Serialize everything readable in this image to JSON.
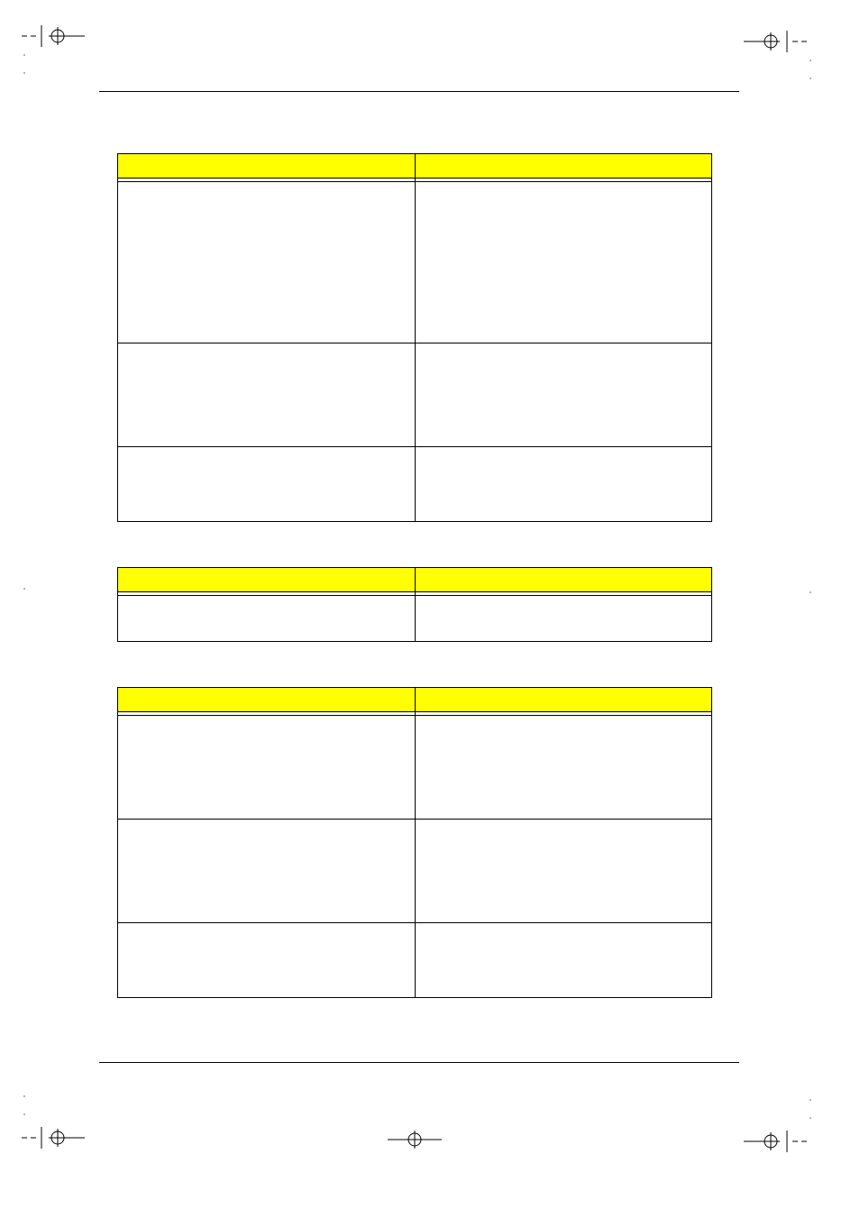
{
  "colors": {
    "header_fill": "#ffff00",
    "table_border": "#000000",
    "page_rule": "#000000"
  },
  "tables": [
    {
      "id": "table-1",
      "headers": [
        "",
        ""
      ],
      "rows": [
        [
          "",
          ""
        ],
        [
          "",
          ""
        ],
        [
          "",
          ""
        ]
      ]
    },
    {
      "id": "table-2",
      "headers": [
        "",
        ""
      ],
      "rows": [
        [
          "",
          ""
        ]
      ]
    },
    {
      "id": "table-3",
      "headers": [
        "",
        ""
      ],
      "rows": [
        [
          "",
          ""
        ],
        [
          "",
          ""
        ],
        [
          "",
          ""
        ]
      ]
    }
  ]
}
